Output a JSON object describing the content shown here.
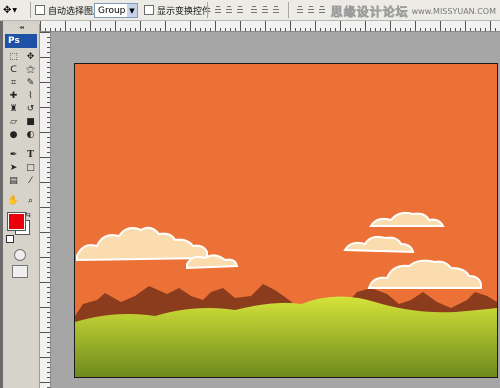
{
  "options_bar": {
    "auto_select_label": "自动选择图层",
    "auto_select_value": "Group",
    "show_transform_label": "显示变换控件"
  },
  "watermark": {
    "text_cn": "思缘设计论坛",
    "text_en": "www.MISSYUAN.COM"
  },
  "toolbox": {
    "logo": "Ps",
    "tools": [
      {
        "icon": "marquee-icon",
        "glyph": "⬚"
      },
      {
        "icon": "move-icon",
        "glyph": "✥"
      },
      {
        "icon": "lasso-icon",
        "glyph": "ᑕ"
      },
      {
        "icon": "magic-wand-icon",
        "glyph": "⚝"
      },
      {
        "icon": "crop-icon",
        "glyph": "⌗"
      },
      {
        "icon": "slice-icon",
        "glyph": "✎"
      },
      {
        "icon": "healing-brush-icon",
        "glyph": "✚"
      },
      {
        "icon": "brush-icon",
        "glyph": "⌇"
      },
      {
        "icon": "clone-stamp-icon",
        "glyph": "♜"
      },
      {
        "icon": "history-brush-icon",
        "glyph": "↺"
      },
      {
        "icon": "eraser-icon",
        "glyph": "▱"
      },
      {
        "icon": "gradient-icon",
        "glyph": "■"
      },
      {
        "icon": "blur-icon",
        "glyph": "●"
      },
      {
        "icon": "dodge-icon",
        "glyph": "◐"
      },
      {
        "icon": "pen-icon",
        "glyph": "✒"
      },
      {
        "icon": "type-icon",
        "glyph": "T"
      },
      {
        "icon": "path-select-icon",
        "glyph": "➤"
      },
      {
        "icon": "shape-icon",
        "glyph": "□"
      },
      {
        "icon": "notes-icon",
        "glyph": "▤"
      },
      {
        "icon": "eyedropper-icon",
        "glyph": "⁄"
      },
      {
        "icon": "hand-icon",
        "glyph": "✋"
      },
      {
        "icon": "zoom-icon",
        "glyph": "⌕"
      }
    ],
    "foreground_color": "#e9000c",
    "background_color": "#ffffff"
  },
  "canvas": {
    "sky_color": "#ec7136",
    "cloud_color": "#fbdcae",
    "mountain_color": "#8b3c1c",
    "grass_top_color": "#d5e33a",
    "grass_bottom_color": "#6e8a1d"
  }
}
